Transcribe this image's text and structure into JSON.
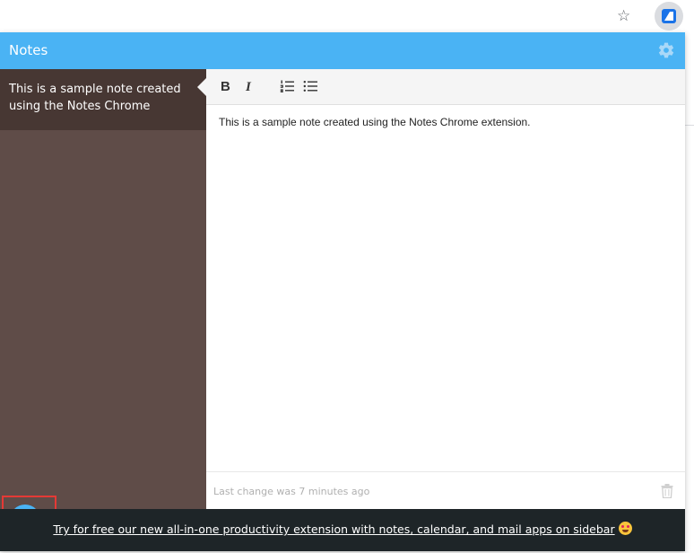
{
  "browser": {
    "bookmark_star_glyph": "☆",
    "extension_icon": "notes-extension-icon",
    "menu_glyph": "⋮"
  },
  "header": {
    "title": "Notes",
    "settings_icon": "gear-icon",
    "color": "#4ab3f4"
  },
  "sidebar": {
    "notes": [
      {
        "preview": "This is a sample note created using the Notes Chrome"
      }
    ],
    "new_note_icon": "pencil-icon",
    "background": "#5f4c48",
    "selected_background": "#473733"
  },
  "toolbar": {
    "bold_label": "B",
    "italic_label": "I",
    "ordered_list_icon": "ordered-list-icon",
    "unordered_list_icon": "unordered-list-icon"
  },
  "editor": {
    "content": "This is a sample note created using the Notes Chrome extension."
  },
  "footer": {
    "last_change": "Last change was 7 minutes ago",
    "delete_icon": "trash-icon"
  },
  "promo": {
    "link_text": "Try for free our new all-in-one productivity extension with notes, calendar, and mail apps on sidebar",
    "emoji_icon": "star-struck-emoji-icon",
    "background": "#1e2528"
  }
}
